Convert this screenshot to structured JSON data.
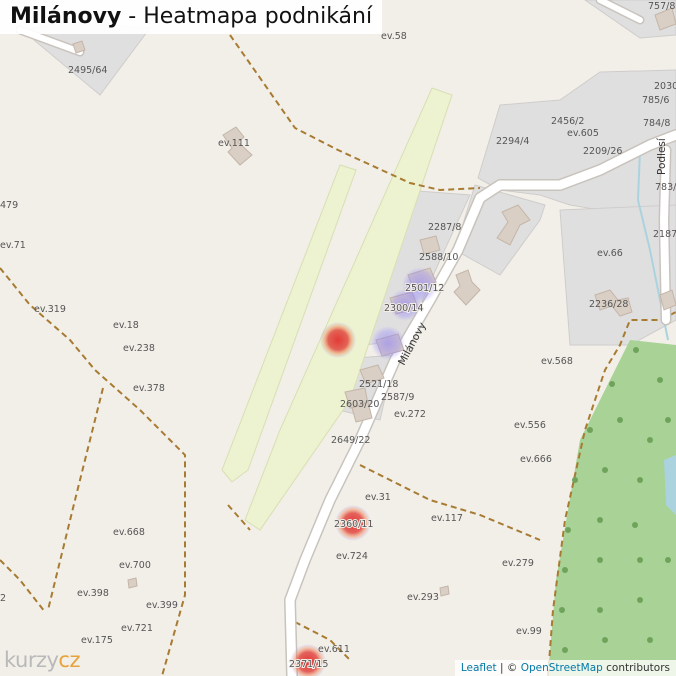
{
  "header": {
    "title_bold": "Milánovy",
    "title_rest": " - Heatmapa podnikání"
  },
  "street_names": {
    "main": "Milánovy",
    "east": "Podlesí"
  },
  "parcel_labels": [
    "2495/64",
    "ev.58",
    "757/8",
    "ev.111",
    "2456/2",
    "ev.605",
    "2294/4",
    "2209/26",
    "784/8",
    "785/6",
    "2030",
    "783/",
    "2187",
    "479",
    "ev.71",
    "2287/8",
    "2588/10",
    "2501/12",
    "2300/14",
    "ev.66",
    "2236/28",
    "ev.319",
    "ev.18",
    "ev.238",
    "ev.378",
    "2521/18",
    "2587/9",
    "2603/20",
    "ev.272",
    "2649/22",
    "ev.568",
    "ev.556",
    "ev.666",
    "ev.31",
    "2360/11",
    "ev.117",
    "ev.668",
    "ev.724",
    "ev.700",
    "ev.279",
    "ev.398",
    "ev.399",
    "ev.293",
    "ev.721",
    "ev.175",
    "ev.99",
    "ev.611",
    "2371/15",
    "2"
  ],
  "heat_points": [
    {
      "level": "high",
      "color": "#e0322d"
    },
    {
      "level": "low",
      "color": "#8a7bff"
    },
    {
      "level": "low",
      "color": "#8a7bff"
    },
    {
      "level": "low",
      "color": "#8a7bff"
    },
    {
      "level": "high",
      "color": "#e0322d"
    },
    {
      "level": "high",
      "color": "#e0322d"
    }
  ],
  "attribution": {
    "leaflet": "Leaflet",
    "sep": " | © ",
    "osm": "OpenStreetMap",
    "rest": " contributors"
  },
  "logo": {
    "part1": "kurzy",
    "part2": "cz"
  },
  "colors": {
    "background": "#f2efe9",
    "landuse_grey": "#e0dfdf",
    "park": "#edf2d0",
    "forest": "#a8d296",
    "water": "#aad3df",
    "road": "#ffffff",
    "road_casing": "#c8c3bd",
    "track": "#a77b32",
    "building": "#d9cfc5"
  }
}
